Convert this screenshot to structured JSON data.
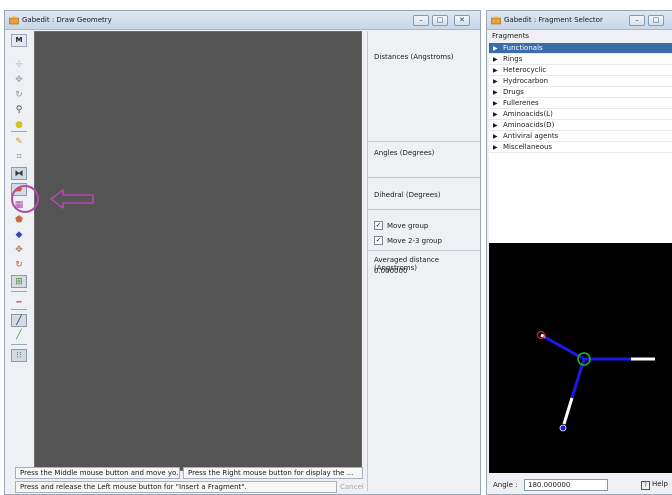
{
  "draw_window": {
    "title": "Gabedit : Draw Geometry",
    "controls": {
      "minimize": "–",
      "maximize": "□",
      "close": "✕"
    }
  },
  "toolbar": {
    "menu_label": "M",
    "tools": [
      {
        "icon": "move-icon",
        "glyph": "✢",
        "color": "#b7c3d0",
        "pressed": false
      },
      {
        "icon": "rotate-icon",
        "glyph": "✥",
        "color": "#9aa4b2",
        "pressed": false
      },
      {
        "icon": "rotate-z-icon",
        "glyph": "↻",
        "color": "#8e98a6",
        "pressed": false
      },
      {
        "icon": "zoom-icon",
        "glyph": "⚲",
        "color": "#404a58",
        "pressed": false
      },
      {
        "icon": "scale-ball-icon",
        "glyph": "●",
        "color": "#d6c11a",
        "pressed": false
      },
      {
        "icon": "pencil-icon",
        "glyph": "✎",
        "color": "#c8a020",
        "pressed": false
      },
      {
        "icon": "measure-icon",
        "glyph": "⌗",
        "color": "#7a8696",
        "pressed": false
      },
      {
        "icon": "split-icon",
        "glyph": "⧓",
        "color": "#333d4a",
        "pressed": true
      },
      {
        "icon": "insert-fragment-icon",
        "glyph": "▰",
        "color": "#cf5a2a",
        "pressed": true
      },
      {
        "icon": "fragment-select-icon",
        "glyph": "▦",
        "color": "#b34ca7",
        "pressed": false
      },
      {
        "icon": "atom-edit-icon",
        "glyph": "⬟",
        "color": "#cc6a3a",
        "pressed": false
      },
      {
        "icon": "atom-color-icon",
        "glyph": "◆",
        "color": "#3346b8",
        "pressed": false
      },
      {
        "icon": "rotate-atom-icon",
        "glyph": "✥",
        "color": "#a67f5a",
        "pressed": false
      },
      {
        "icon": "cycle-icon",
        "glyph": "↻",
        "color": "#c95a46",
        "pressed": false
      },
      {
        "icon": "select-all-icon",
        "glyph": "⊞",
        "color": "#5a8a3a",
        "pressed": true
      },
      {
        "icon": "dashes-icon",
        "glyph": "┅",
        "color": "#cc3333",
        "pressed": false
      },
      {
        "icon": "bond-line-icon",
        "glyph": "╱",
        "color": "#2a2a6a",
        "pressed": true
      },
      {
        "icon": "bond-color-icon",
        "glyph": "╱",
        "color": "#2a9a3a",
        "pressed": false
      },
      {
        "icon": "grid-icon",
        "glyph": "⁝⁝",
        "color": "#667080",
        "pressed": true
      }
    ]
  },
  "info_panel": {
    "distances_label": "Distances (Angstroms)",
    "angles_label": "Angles (Degrees)",
    "dihedral_label": "Dihedral (Degrees)",
    "move_group_label": "Move group",
    "move_23_group_label": "Move 2-3 group",
    "check_mark": "✓",
    "averaged_label": "Averaged distance (Angstroms)",
    "averaged_value": "0.000000"
  },
  "status_bar": {
    "middle_hint": "Press the Middle mouse button and move yo...",
    "right_hint": "Press the Right mouse button for display the ...",
    "left_hint": "Press and release the Left mouse button for \"Insert a Fragment\".",
    "cancel_label": "Cancel"
  },
  "fragment_window": {
    "title": "Gabedit : Fragment Selector",
    "header": "Fragments",
    "expander": "▶",
    "items": [
      {
        "label": "Functionals",
        "selected": true
      },
      {
        "label": "Rings",
        "selected": false
      },
      {
        "label": "Heterocyclic",
        "selected": false
      },
      {
        "label": "Hydrocarbon",
        "selected": false
      },
      {
        "label": "Drugs",
        "selected": false
      },
      {
        "label": "Fullerenes",
        "selected": false
      },
      {
        "label": "Aminoacids(L)",
        "selected": false
      },
      {
        "label": "Aminoacids(D)",
        "selected": false
      },
      {
        "label": "Antiviral agents",
        "selected": false
      },
      {
        "label": "Miscellaneous",
        "selected": false
      }
    ],
    "angle_label": "Angle :",
    "angle_value": "180.000000",
    "help_label": "Help",
    "help_glyph": "?"
  },
  "colors": {
    "selection": "#3b6bab",
    "canvas": "#545454",
    "highlight": "#b04aa8",
    "bond": "#1a1ae6",
    "center_atom": "#22bb22",
    "red_atom": "#dd2222",
    "hydrogen": "#ffffff"
  }
}
